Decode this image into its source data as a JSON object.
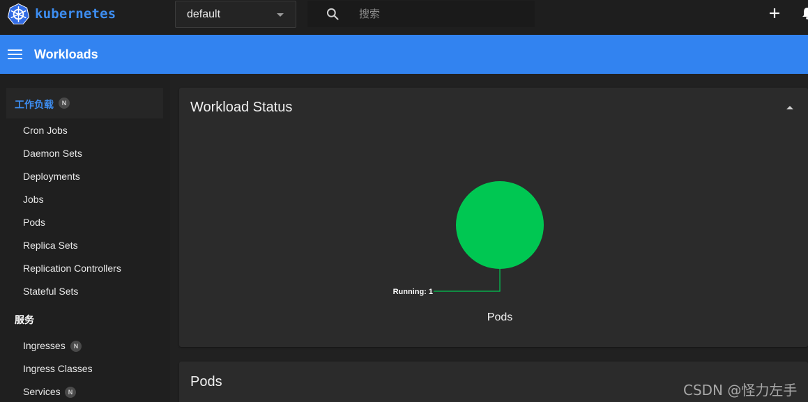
{
  "app": {
    "brand": "kubernetes",
    "accent_color": "#3283f0",
    "logo_icon": "kubernetes-helm-icon"
  },
  "topbar": {
    "namespace": "default",
    "search_placeholder": "搜索",
    "create_icon": "plus-icon",
    "notifications_icon": "bell-icon"
  },
  "header": {
    "title": "Workloads"
  },
  "sidebar": {
    "sections": [
      {
        "label": "工作负载",
        "badge": "N",
        "items": [
          "Cron Jobs",
          "Daemon Sets",
          "Deployments",
          "Jobs",
          "Pods",
          "Replica Sets",
          "Replication Controllers",
          "Stateful Sets"
        ]
      },
      {
        "label": "服务",
        "items": [
          {
            "label": "Ingresses",
            "badge": "N"
          },
          {
            "label": "Ingress Classes"
          },
          {
            "label": "Services",
            "badge": "N"
          }
        ]
      }
    ]
  },
  "main": {
    "workload_status_title": "Workload Status",
    "pods_title": "Pods"
  },
  "chart_data": {
    "type": "pie",
    "title": "",
    "categories": [
      "Running"
    ],
    "values": [
      1
    ],
    "colors": [
      "#00c752"
    ],
    "slice_labels": [
      "Running: 1"
    ],
    "caption": "Pods"
  },
  "watermark": "CSDN @怪力左手"
}
